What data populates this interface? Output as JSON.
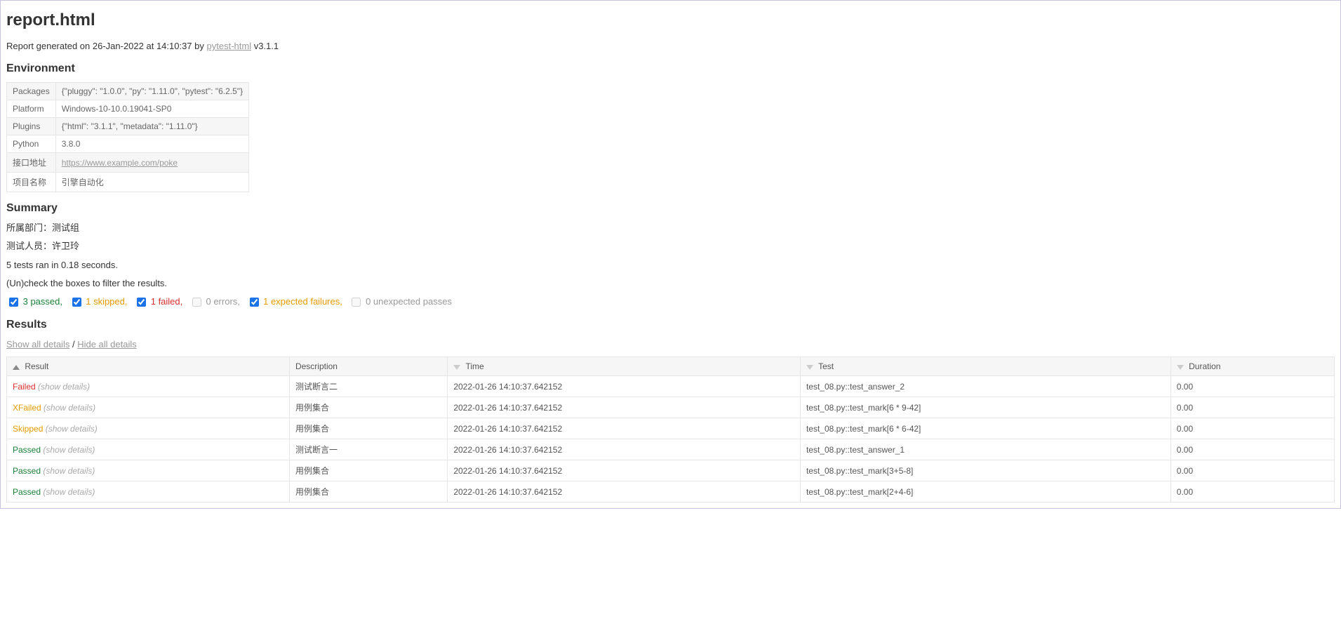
{
  "title": "report.html",
  "subtitle_prefix": "Report generated on ",
  "generated_on": "26-Jan-2022 at 14:10:37",
  "by_text": " by ",
  "generator_link": "pytest-html",
  "generator_version": " v3.1.1",
  "headings": {
    "environment": "Environment",
    "summary": "Summary",
    "results": "Results"
  },
  "environment": [
    {
      "key": "Packages",
      "value": "{\"pluggy\": \"1.0.0\", \"py\": \"1.11.0\", \"pytest\": \"6.2.5\"}"
    },
    {
      "key": "Platform",
      "value": "Windows-10-10.0.19041-SP0"
    },
    {
      "key": "Plugins",
      "value": "{\"html\": \"3.1.1\", \"metadata\": \"1.11.0\"}"
    },
    {
      "key": "Python",
      "value": "3.8.0"
    },
    {
      "key": "接口地址",
      "value": "https://www.example.com/poke",
      "link": true
    },
    {
      "key": "项目名称",
      "value": "引擎自动化"
    }
  ],
  "summary_lines": {
    "department": "所属部门：测试组",
    "tester": "测试人员：许卫玲",
    "tests_ran": "5 tests ran in 0.18 seconds.",
    "filter_hint": "(Un)check the boxes to filter the results."
  },
  "filters": {
    "passed": {
      "label": "3 passed,",
      "checked": true,
      "disabled": false,
      "cls": "passed"
    },
    "skipped": {
      "label": "1 skipped,",
      "checked": true,
      "disabled": false,
      "cls": "skipped"
    },
    "failed": {
      "label": "1 failed,",
      "checked": true,
      "disabled": false,
      "cls": "failed"
    },
    "errors": {
      "label": "0 errors,",
      "checked": false,
      "disabled": true,
      "cls": "errors"
    },
    "xfailed": {
      "label": "1 expected failures,",
      "checked": true,
      "disabled": false,
      "cls": "xfailed"
    },
    "xpassed": {
      "label": "0 unexpected passes",
      "checked": false,
      "disabled": true,
      "cls": "xpassed"
    }
  },
  "results_links": {
    "show_all": "Show all details",
    "sep": " / ",
    "hide_all": "Hide all details"
  },
  "columns": {
    "result": "Result",
    "description": "Description",
    "time": "Time",
    "test": "Test",
    "duration": "Duration"
  },
  "details_label": "(show details)",
  "rows": [
    {
      "status": "Failed",
      "cls": "failed",
      "description": "测试断言二",
      "time": "2022-01-26 14:10:37.642152",
      "test": "test_08.py::test_answer_2",
      "duration": "0.00"
    },
    {
      "status": "XFailed",
      "cls": "xfailed",
      "description": "用例集合",
      "time": "2022-01-26 14:10:37.642152",
      "test": "test_08.py::test_mark[6 * 9-42]",
      "duration": "0.00"
    },
    {
      "status": "Skipped",
      "cls": "skipped",
      "description": "用例集合",
      "time": "2022-01-26 14:10:37.642152",
      "test": "test_08.py::test_mark[6 * 6-42]",
      "duration": "0.00"
    },
    {
      "status": "Passed",
      "cls": "passed",
      "description": "测试断言一",
      "time": "2022-01-26 14:10:37.642152",
      "test": "test_08.py::test_answer_1",
      "duration": "0.00"
    },
    {
      "status": "Passed",
      "cls": "passed",
      "description": "用例集合",
      "time": "2022-01-26 14:10:37.642152",
      "test": "test_08.py::test_mark[3+5-8]",
      "duration": "0.00"
    },
    {
      "status": "Passed",
      "cls": "passed",
      "description": "用例集合",
      "time": "2022-01-26 14:10:37.642152",
      "test": "test_08.py::test_mark[2+4-6]",
      "duration": "0.00"
    }
  ]
}
